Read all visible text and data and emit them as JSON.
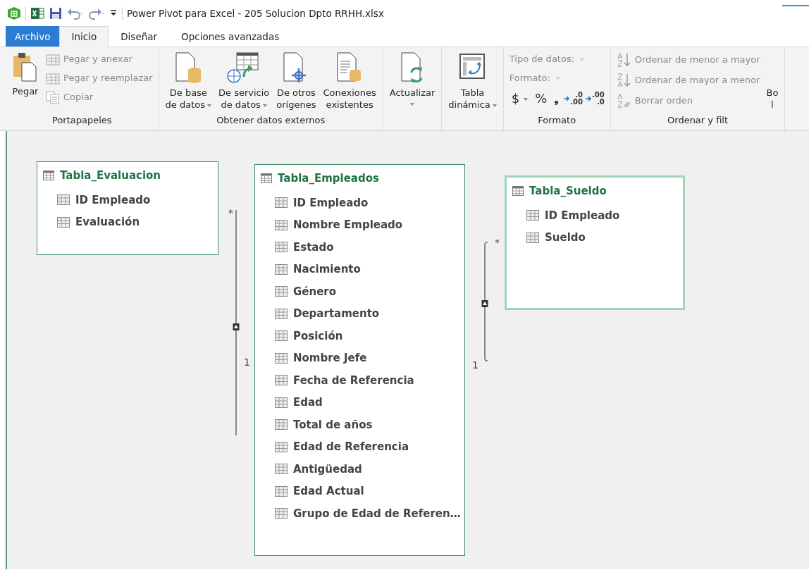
{
  "title_bar": {
    "title": "Power Pivot para Excel - 205 Solucion  Dpto RRHH.xlsx"
  },
  "tabs": [
    {
      "label": "Archivo",
      "kind": "file",
      "selected": false
    },
    {
      "label": "Inicio",
      "kind": "tab",
      "selected": true
    },
    {
      "label": "Diseñar",
      "kind": "tab",
      "selected": false
    },
    {
      "label": "Opciones avanzadas",
      "kind": "tab",
      "selected": false
    }
  ],
  "ribbon_groups": [
    {
      "label": "Portapapeles",
      "buttons": [
        {
          "kind": "large",
          "lines": [
            "Pegar"
          ],
          "caret": false,
          "disabled": false
        },
        {
          "kind": "small",
          "lines": [
            "Pegar y anexar"
          ],
          "disabled": true
        },
        {
          "kind": "small",
          "lines": [
            "Pegar y reemplazar"
          ],
          "disabled": true
        },
        {
          "kind": "small",
          "lines": [
            "Copiar"
          ],
          "disabled": true
        }
      ]
    },
    {
      "label": "Obtener datos externos",
      "buttons": [
        {
          "kind": "large",
          "lines": [
            "De base",
            "de datos"
          ],
          "caret": true,
          "disabled": false
        },
        {
          "kind": "large",
          "lines": [
            "De servicio",
            "de datos"
          ],
          "caret": true,
          "disabled": false
        },
        {
          "kind": "large",
          "lines": [
            "De otros",
            "orígenes"
          ],
          "caret": false,
          "disabled": false
        },
        {
          "kind": "large",
          "lines": [
            "Conexiones",
            "existentes"
          ],
          "caret": false,
          "disabled": false
        }
      ]
    },
    {
      "buttons": [
        {
          "kind": "large",
          "lines": [
            "Actualizar"
          ],
          "caret": true,
          "disabled": false
        }
      ]
    },
    {
      "buttons": [
        {
          "kind": "large",
          "lines": [
            "Tabla",
            "dinámica"
          ],
          "caret": true,
          "disabled": false
        }
      ]
    },
    {
      "label": "Formato",
      "buttons": [
        {
          "kind": "combo",
          "lines": [
            "Tipo de datos:"
          ],
          "disabled": true
        },
        {
          "kind": "combo",
          "lines": [
            "Formato:"
          ],
          "disabled": true
        },
        {
          "kind": "glyph",
          "lines": [
            "$"
          ],
          "caret": true,
          "disabled": false
        },
        {
          "kind": "glyph",
          "lines": [
            "%"
          ],
          "caret": false,
          "disabled": false
        },
        {
          "kind": "glyph",
          "lines": [
            "❟"
          ],
          "caret": false,
          "disabled": false
        },
        {
          "kind": "decimal",
          "lines": [
            ".0",
            ".00"
          ],
          "disabled": false
        },
        {
          "kind": "decimal",
          "lines": [
            ".00",
            ".0"
          ],
          "disabled": false
        }
      ]
    },
    {
      "label": "Ordenar y filt",
      "buttons": [
        {
          "kind": "small",
          "lines": [
            "Ordenar de menor a mayor"
          ],
          "disabled": true
        },
        {
          "kind": "small",
          "lines": [
            "Ordenar de mayor a menor"
          ],
          "disabled": true
        },
        {
          "kind": "small",
          "lines": [
            "Borrar orden"
          ],
          "disabled": true
        },
        {
          "kind": "large",
          "lines": [
            "Bo",
            "l"
          ],
          "caret": false,
          "disabled": false
        }
      ]
    }
  ],
  "diagram": {
    "tables": [
      {
        "name": "Tabla_Evaluacion",
        "selected": false,
        "fields": [
          "ID Empleado",
          "Evaluación"
        ]
      },
      {
        "name": "Tabla_Empleados",
        "selected": false,
        "fields": [
          "ID Empleado",
          "Nombre Empleado",
          "Estado",
          "Nacimiento",
          "Género",
          "Departamento",
          "Posición",
          "Nombre Jefe",
          "Fecha de Referencia",
          "Edad",
          "Total de años",
          "Edad de Referencia",
          "Antigüedad",
          "Edad Actual",
          "Grupo de Edad de Referen…"
        ]
      },
      {
        "name": "Tabla_Sueldo",
        "selected": true,
        "fields": [
          "ID Empleado",
          "Sueldo"
        ]
      }
    ],
    "relationships": [
      {
        "many": "*",
        "one": "1"
      },
      {
        "many": "*",
        "one": "1"
      }
    ]
  }
}
